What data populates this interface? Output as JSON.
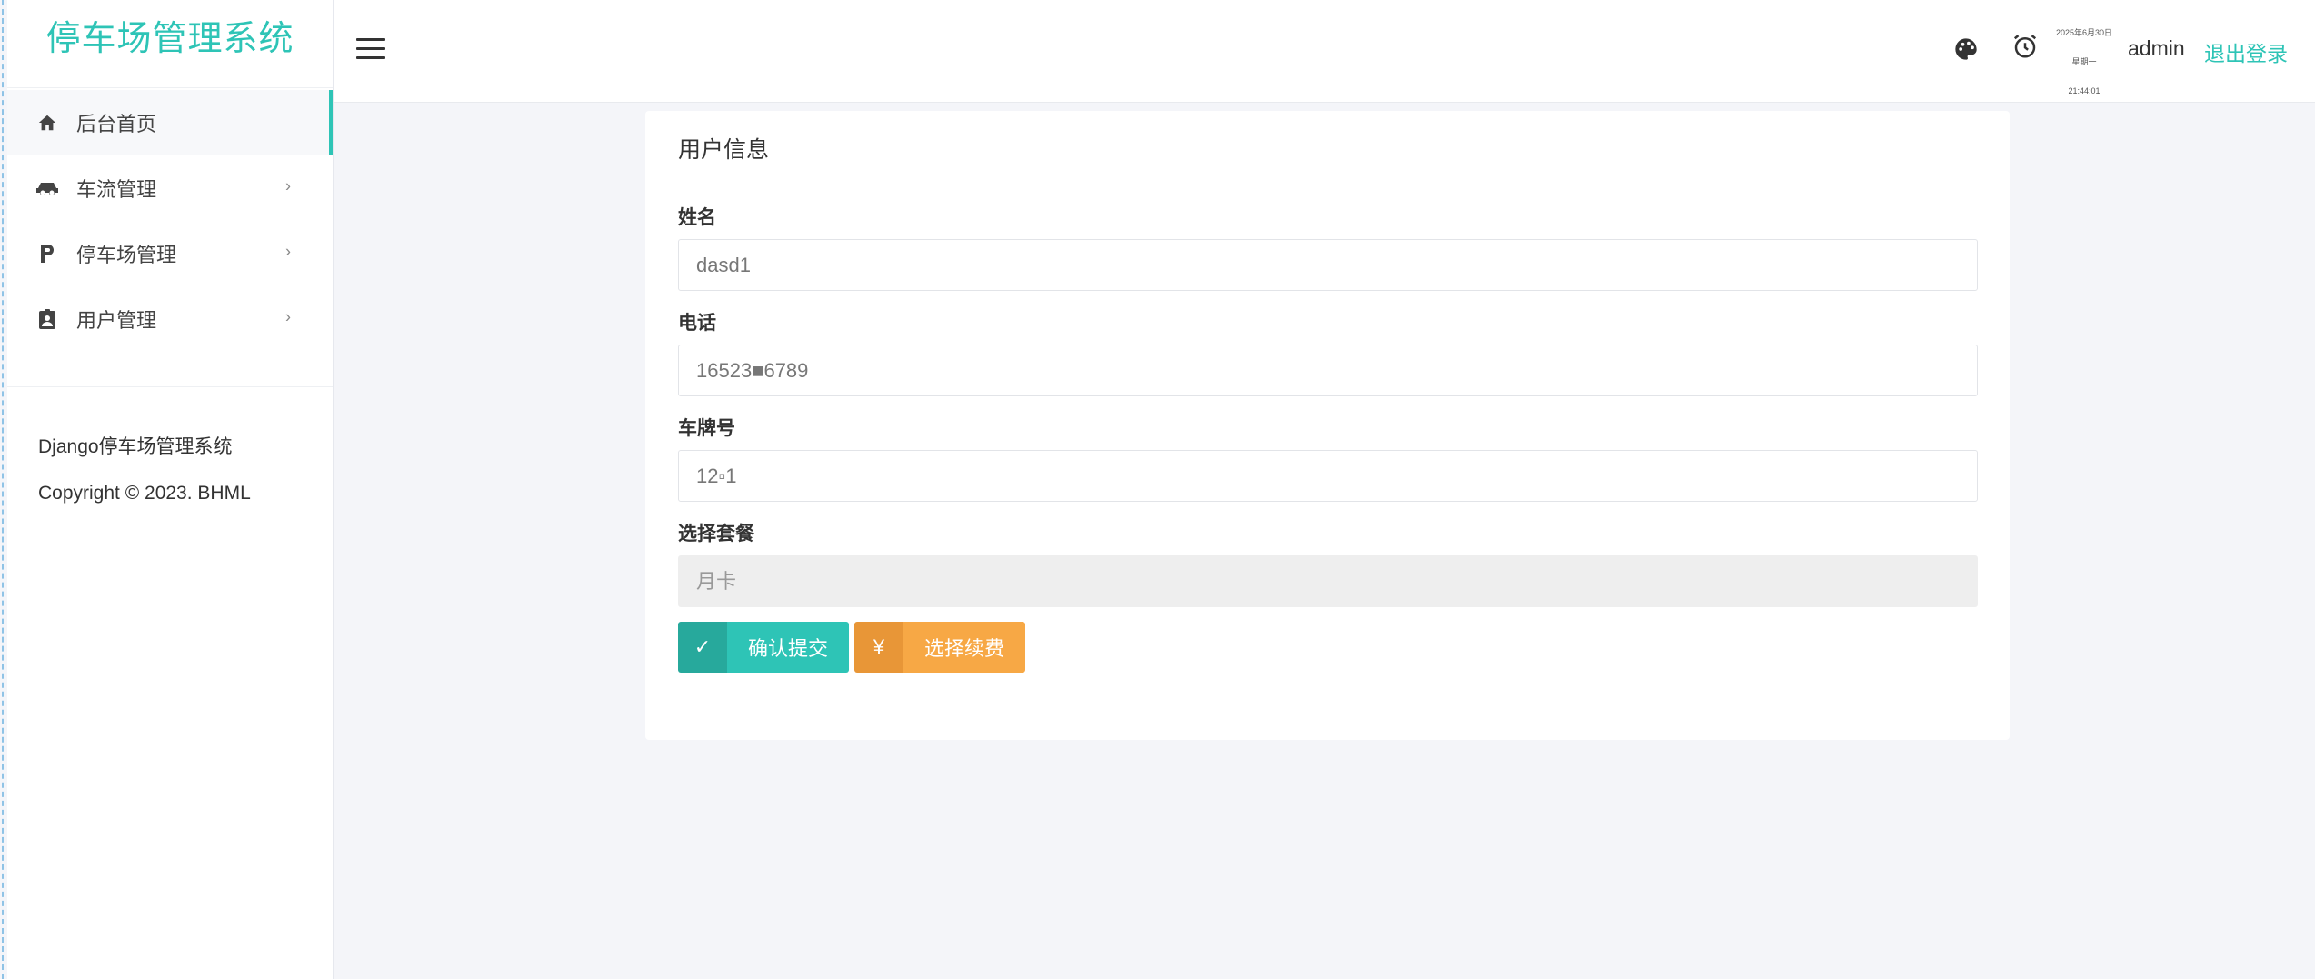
{
  "brand": {
    "title": "停车场管理系统",
    "color": "#2ec4b6"
  },
  "sidebar": {
    "items": [
      {
        "label": "后台首页",
        "icon": "home-icon",
        "active": true
      },
      {
        "label": "车流管理",
        "icon": "car-icon",
        "arrow": "›"
      },
      {
        "label": "停车场管理",
        "icon": "parking-p-icon",
        "arrow": "›"
      },
      {
        "label": "用户管理",
        "icon": "user-badge-icon",
        "arrow": "›"
      }
    ],
    "footer": {
      "line1": "Django停车场管理系统",
      "line2": "Copyright © 2023. BHML"
    }
  },
  "header": {
    "clock": {
      "date": "2025年6月30日",
      "weekday": "星期一",
      "time": "21:44:01"
    },
    "user": "admin",
    "logout": "退出登录"
  },
  "card": {
    "title": "用户信息",
    "fields": {
      "name_label": "姓名",
      "name_value": "dasd1",
      "phone_label": "电话",
      "phone_value": "16523■6789",
      "plate_label": "车牌号",
      "plate_value": "12▫1",
      "package_label": "选择套餐",
      "package_value": "月卡"
    },
    "buttons": {
      "submit": {
        "icon": "✓",
        "label": "确认提交"
      },
      "renew": {
        "icon": "¥",
        "label": "选择续费"
      }
    }
  },
  "colors": {
    "accent": "#2ec4b6",
    "orange": "#f7a845",
    "background": "#f4f5f9"
  }
}
